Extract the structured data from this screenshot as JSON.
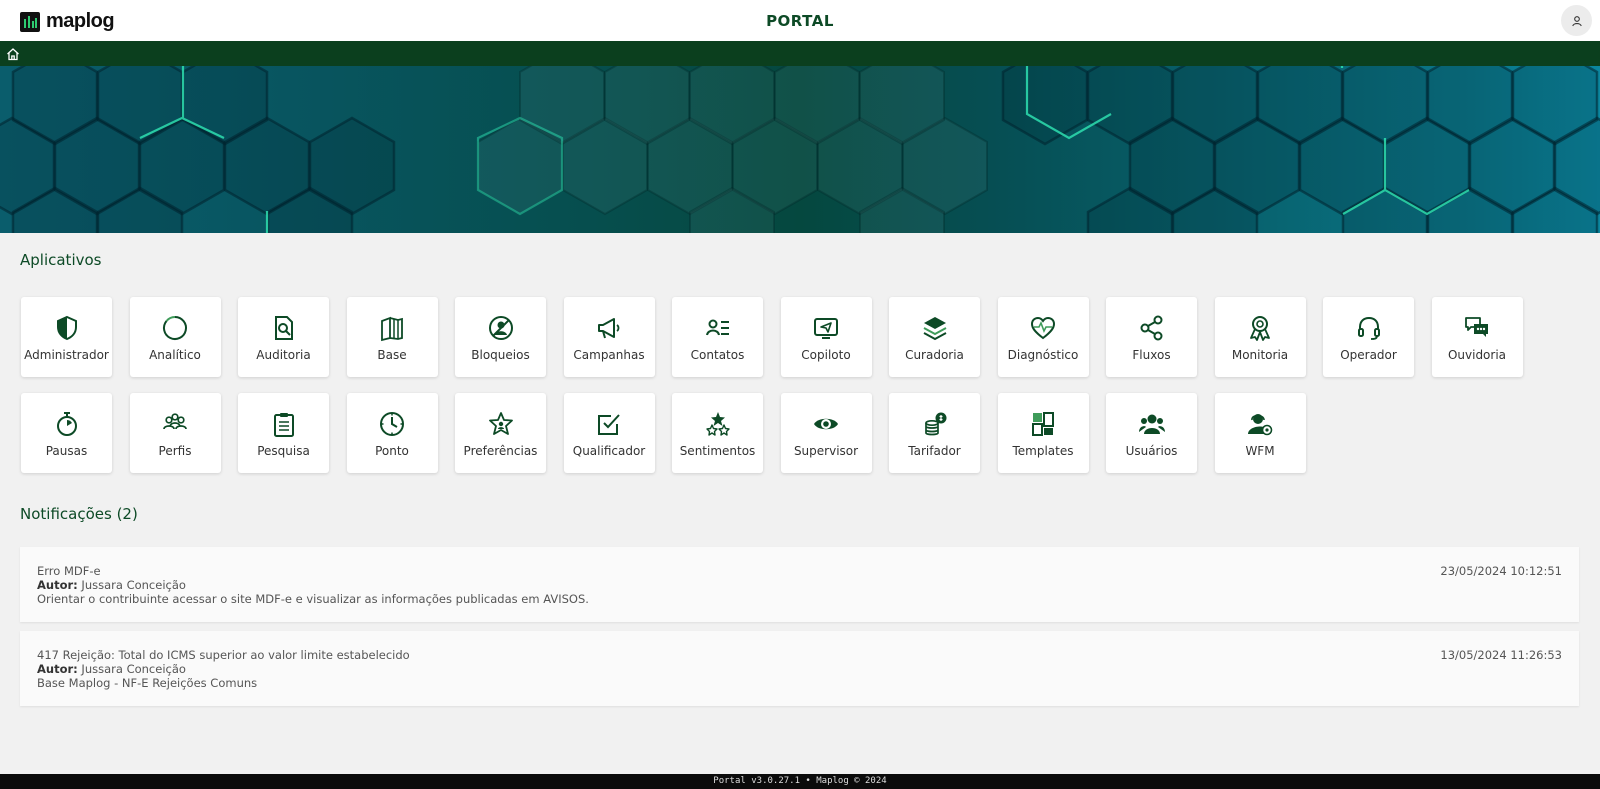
{
  "header": {
    "logo_text": "maplog",
    "title": "PORTAL"
  },
  "apps": {
    "title": "Aplicativos",
    "items": [
      {
        "label": "Administrador",
        "icon": "shield-icon"
      },
      {
        "label": "Analítico",
        "icon": "circle-progress-icon"
      },
      {
        "label": "Auditoria",
        "icon": "document-search-icon"
      },
      {
        "label": "Base",
        "icon": "books-icon"
      },
      {
        "label": "Bloqueios",
        "icon": "user-blocked-icon"
      },
      {
        "label": "Campanhas",
        "icon": "megaphone-icon"
      },
      {
        "label": "Contatos",
        "icon": "contact-list-icon"
      },
      {
        "label": "Copiloto",
        "icon": "screen-send-icon"
      },
      {
        "label": "Curadoria",
        "icon": "layers-icon"
      },
      {
        "label": "Diagnóstico",
        "icon": "heart-pulse-icon"
      },
      {
        "label": "Fluxos",
        "icon": "share-nodes-icon"
      },
      {
        "label": "Monitoria",
        "icon": "award-icon"
      },
      {
        "label": "Operador",
        "icon": "headset-icon"
      },
      {
        "label": "Ouvidoria",
        "icon": "chat-bubbles-icon"
      },
      {
        "label": "Pausas",
        "icon": "stopwatch-icon"
      },
      {
        "label": "Perfis",
        "icon": "users-group-icon"
      },
      {
        "label": "Pesquisa",
        "icon": "clipboard-icon"
      },
      {
        "label": "Ponto",
        "icon": "clock-icon"
      },
      {
        "label": "Preferências",
        "icon": "star-badge-icon"
      },
      {
        "label": "Qualificador",
        "icon": "checkbox-icon"
      },
      {
        "label": "Sentimentos",
        "icon": "stars-icon"
      },
      {
        "label": "Supervisor",
        "icon": "eye-icon"
      },
      {
        "label": "Tarifador",
        "icon": "coins-icon"
      },
      {
        "label": "Templates",
        "icon": "template-icon"
      },
      {
        "label": "Usuários",
        "icon": "users-icon"
      },
      {
        "label": "WFM",
        "icon": "user-gear-icon"
      }
    ]
  },
  "notifications": {
    "title": "Notificações (2)",
    "author_label": "Autor:",
    "items": [
      {
        "title": "Erro MDF-e",
        "author": "Jussara Conceição",
        "body": "Orientar o contribuinte acessar o site MDF-e e visualizar as informações publicadas em AVISOS.",
        "date": "23/05/2024 10:12:51"
      },
      {
        "title": "417 Rejeição: Total do ICMS superior ao valor limite estabelecido",
        "author": "Jussara Conceição",
        "body": "Base Maplog - NF-E Rejeições Comuns",
        "date": "13/05/2024 11:26:53"
      }
    ]
  },
  "footer": {
    "text": "Portal v3.0.27.1 • Maplog © 2024"
  },
  "colors": {
    "accent": "#0d4a26",
    "navbar": "#0b3f1e",
    "icon": "#0d4a26",
    "icon_light": "#3f9c5a"
  }
}
